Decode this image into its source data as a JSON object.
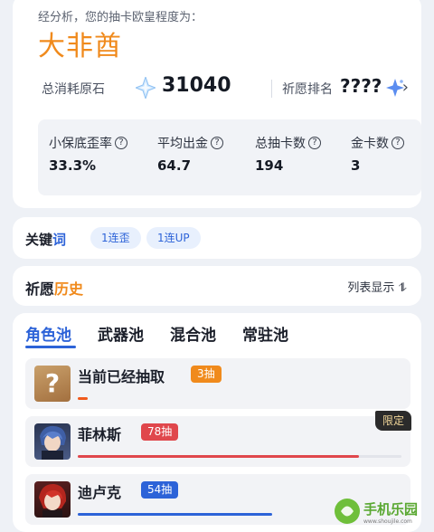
{
  "summary": {
    "heading": "经分析，您的抽卡欧皇程度为：",
    "level": "大非酋",
    "total_label": "总消耗原石",
    "total_value": "31040",
    "rank_label": "祈愿排名",
    "rank_value": "????",
    "chevron": "›",
    "metrics": [
      {
        "label": "小保底歪率",
        "value": "33.3%"
      },
      {
        "label": "平均出金",
        "value": "64.7"
      },
      {
        "label": "总抽卡数",
        "value": "194"
      },
      {
        "label": "金卡数",
        "value": "3"
      }
    ]
  },
  "keywords": {
    "title_main": "关键",
    "title_accent": "词",
    "tags": [
      "1连歪",
      "1连UP"
    ]
  },
  "history": {
    "title_main": "祈愿",
    "title_accent": "历史",
    "toggle_label": "列表显示 ⥮"
  },
  "pools": {
    "tabs": [
      "角色池",
      "武器池",
      "混合池",
      "常驻池"
    ],
    "active_tab": 0,
    "entries": [
      {
        "name": "当前已经抽取",
        "badge": "3抽",
        "badge_color": "#f08a1c",
        "bar_color": "#f05a1c",
        "progress": 0.03,
        "limited": ""
      },
      {
        "name": "菲林斯",
        "badge": "78抽",
        "badge_color": "#e0474c",
        "bar_color": "#e0474c",
        "progress": 0.87,
        "limited": "限定"
      },
      {
        "name": "迪卢克",
        "badge": "54抽",
        "badge_color": "#2d63d8",
        "bar_color": "#2d63d8",
        "progress": 0.6,
        "limited": ""
      }
    ],
    "unknown_avatar_glyph": "?"
  },
  "watermark": {
    "text": "手机乐园",
    "subtext": "www.shoujile.com"
  },
  "colors": {
    "accent_blue": "#2d63d8",
    "accent_orange": "#f08a1c",
    "red": "#e0474c"
  }
}
